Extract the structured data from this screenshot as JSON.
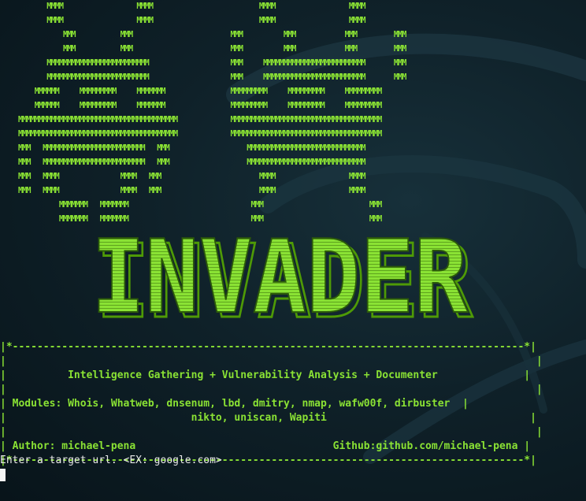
{
  "ascii_art": "       MMMM                  MMMM                          MMMM                  MMMM\n       MMMM                  MMMM                          MMMM                  MMMM\n           MMM           MMM                        MMM          MMM            MMM         MMM\n           MMM           MMM                        MMM          MMM            MMM         MMM\n       MMMMMMMMMMMMMMMMMMMMMMMMM                    MMM     MMMMMMMMMMMMMMMMMMMMMMMMM       MMM\n       MMMMMMMMMMMMMMMMMMMMMMMMM                    MMM     MMMMMMMMMMMMMMMMMMMMMMMMM       MMM\n    MMMMMM     MMMMMMMMM     MMMMMMM                MMMMMMMMM     MMMMMMMMM     MMMMMMMMM\n    MMMMMM     MMMMMMMMM     MMMMMMM                MMMMMMMMM     MMMMMMMMM     MMMMMMMMM\nMMMMMMMMMMMMMMMMMMMMMMMMMMMMMMMMMMMMMMM             MMMMMMMMMMMMMMMMMMMMMMMMMMMMMMMMMMMMM\nMMMMMMMMMMMMMMMMMMMMMMMMMMMMMMMMMMMMMMM             MMMMMMMMMMMMMMMMMMMMMMMMMMMMMMMMMMMMM\nMMM   MMMMMMMMMMMMMMMMMMMMMMMMM   MMM                   MMMMMMMMMMMMMMMMMMMMMMMMMMMMM\nMMM   MMMMMMMMMMMMMMMMMMMMMMMMM   MMM                   MMMMMMMMMMMMMMMMMMMMMMMMMMMMM\nMMM   MMMM               MMMM   MMM                        MMMM                  MMMM\nMMM   MMMM               MMMM   MMM                        MMMM                  MMMM\n          MMMMMMM   MMMMMMM                              MMM                          MMM\n          MMMMMMM   MMMMMMM                              MMM                          MMM",
  "logo": {
    "text": "INVADER",
    "color": "#8ae234",
    "shadow_color": "#4e9a06"
  },
  "info_box": "|*-----------------------------------------------------------------------------------*|\n|                                                                                      |\n|          Intelligence Gathering + Vulnerability Analysis + Documenter              |\n|                                                                                      |\n| Modules: Whois, Whatweb, dnsenum, lbd, dmitry, nmap, wafw00f, dirbuster  |\n|                              nikto, uniscan, Wapiti                                 |\n|                                                                                      |\n| Author: michael-pena                                Github:github.com/michael-pena |\n|*-----------------------------------------------------------------------------------*|",
  "prompt": {
    "text": "Enter a target url. <EX: google.com>",
    "input_value": ""
  },
  "colors": {
    "accent_green": "#8ae234",
    "text_white": "#e8e8e8",
    "background": "#0f2129"
  },
  "icons": {
    "cursor": "block-cursor"
  }
}
